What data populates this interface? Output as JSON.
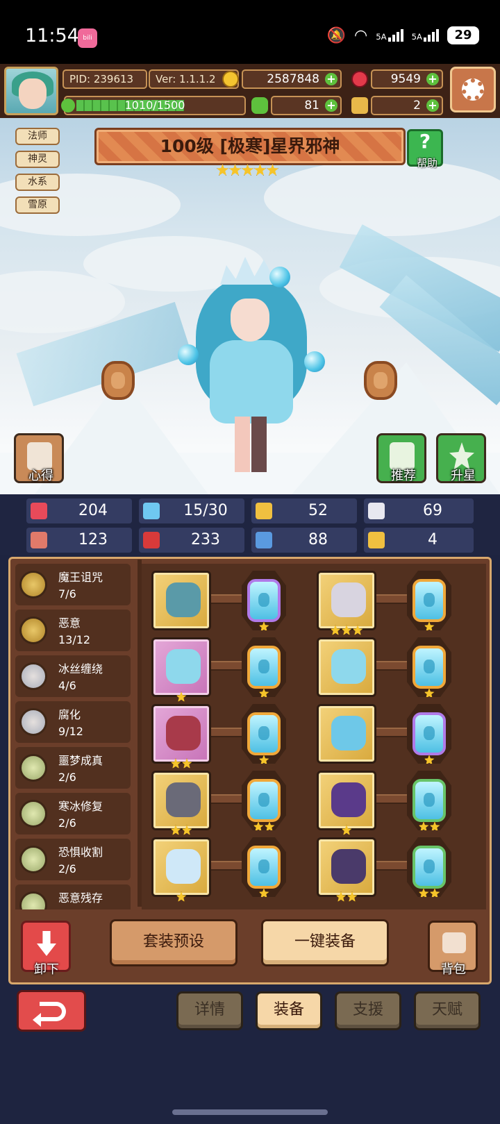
{
  "status_bar": {
    "time": "11:54",
    "app_badge": "bilibili",
    "net1": "5A",
    "net2": "5A",
    "battery": "29"
  },
  "hud": {
    "pid": "PID: 239613",
    "version": "Ver: 1.1.1.2",
    "gold": "2587848",
    "gems": "9549",
    "xp": "1010/1500",
    "xp_fraction": 0.673,
    "clover": "81",
    "key": "2"
  },
  "hero": {
    "tags": [
      "法师",
      "神灵",
      "水系",
      "雪原"
    ],
    "title": "100级 [极寒]星界邪神",
    "stars": 5,
    "help_label": "帮助",
    "tips_label": "心得",
    "recommend_label": "推荐",
    "starup_label": "升星"
  },
  "stats": [
    {
      "icon": "heart-icon",
      "color": "#e84a5a",
      "value": "204"
    },
    {
      "icon": "water-drop-icon",
      "color": "#6fc8f0",
      "value": "15/30"
    },
    {
      "icon": "shield-icon",
      "color": "#f0c040",
      "value": "52"
    },
    {
      "icon": "wing-icon",
      "color": "#e8e8f0",
      "value": "69"
    },
    {
      "icon": "fist-icon",
      "color": "#e07a6a",
      "value": "123"
    },
    {
      "icon": "book-icon",
      "color": "#d83a3a",
      "value": "233"
    },
    {
      "icon": "scroll-icon",
      "color": "#5a9ae0",
      "value": "88"
    },
    {
      "icon": "horseshoe-icon",
      "color": "#f0c040",
      "value": "4"
    }
  ],
  "sets": [
    {
      "name": "魔王诅咒",
      "count": "7/6",
      "medal": "gold"
    },
    {
      "name": "恶意",
      "count": "13/12",
      "medal": "gold"
    },
    {
      "name": "冰丝缠绕",
      "count": "4/6",
      "medal": "ice"
    },
    {
      "name": "腐化",
      "count": "9/12",
      "medal": "ice"
    },
    {
      "name": "噩梦成真",
      "count": "2/6",
      "medal": "green"
    },
    {
      "name": "寒冰修复",
      "count": "2/6",
      "medal": "green"
    },
    {
      "name": "恐惧收割",
      "count": "2/6",
      "medal": "green"
    },
    {
      "name": "恶意残存",
      "count": "",
      "medal": "green"
    }
  ],
  "equipment": [
    {
      "item": "staff-icon",
      "frame": "gold",
      "stars": 0,
      "gem": "purple",
      "gem_stars": 1
    },
    {
      "item": "horned-helmet-icon",
      "frame": "gold",
      "stars": 3,
      "gem": "gold",
      "gem_stars": 1
    },
    {
      "item": "ice-crown-icon",
      "frame": "pink",
      "stars": 1,
      "gem": "gold",
      "gem_stars": 1
    },
    {
      "item": "ice-armor-icon",
      "frame": "gold",
      "stars": 0,
      "gem": "gold",
      "gem_stars": 1
    },
    {
      "item": "necklace-icon",
      "frame": "pink",
      "stars": 2,
      "gem": "gold",
      "gem_stars": 1
    },
    {
      "item": "ice-glove-icon",
      "frame": "gold",
      "stars": 0,
      "gem": "purple",
      "gem_stars": 1
    },
    {
      "item": "rock-orb-icon",
      "frame": "gold",
      "stars": 2,
      "gem": "gold",
      "gem_stars": 2
    },
    {
      "item": "dark-chest-icon",
      "frame": "gold",
      "stars": 1,
      "gem": "green",
      "gem_stars": 2
    },
    {
      "item": "ice-helmet-icon",
      "frame": "gold",
      "stars": 1,
      "gem": "gold",
      "gem_stars": 1
    },
    {
      "item": "dark-boots-icon",
      "frame": "gold",
      "stars": 2,
      "gem": "green",
      "gem_stars": 2
    }
  ],
  "actions": {
    "unequip": "卸下",
    "preset": "套装预设",
    "equip_all": "一键装备",
    "bag": "背包"
  },
  "tabs": [
    {
      "label": "详情",
      "active": false
    },
    {
      "label": "装备",
      "active": true
    },
    {
      "label": "支援",
      "active": false
    },
    {
      "label": "天赋",
      "active": false
    }
  ]
}
